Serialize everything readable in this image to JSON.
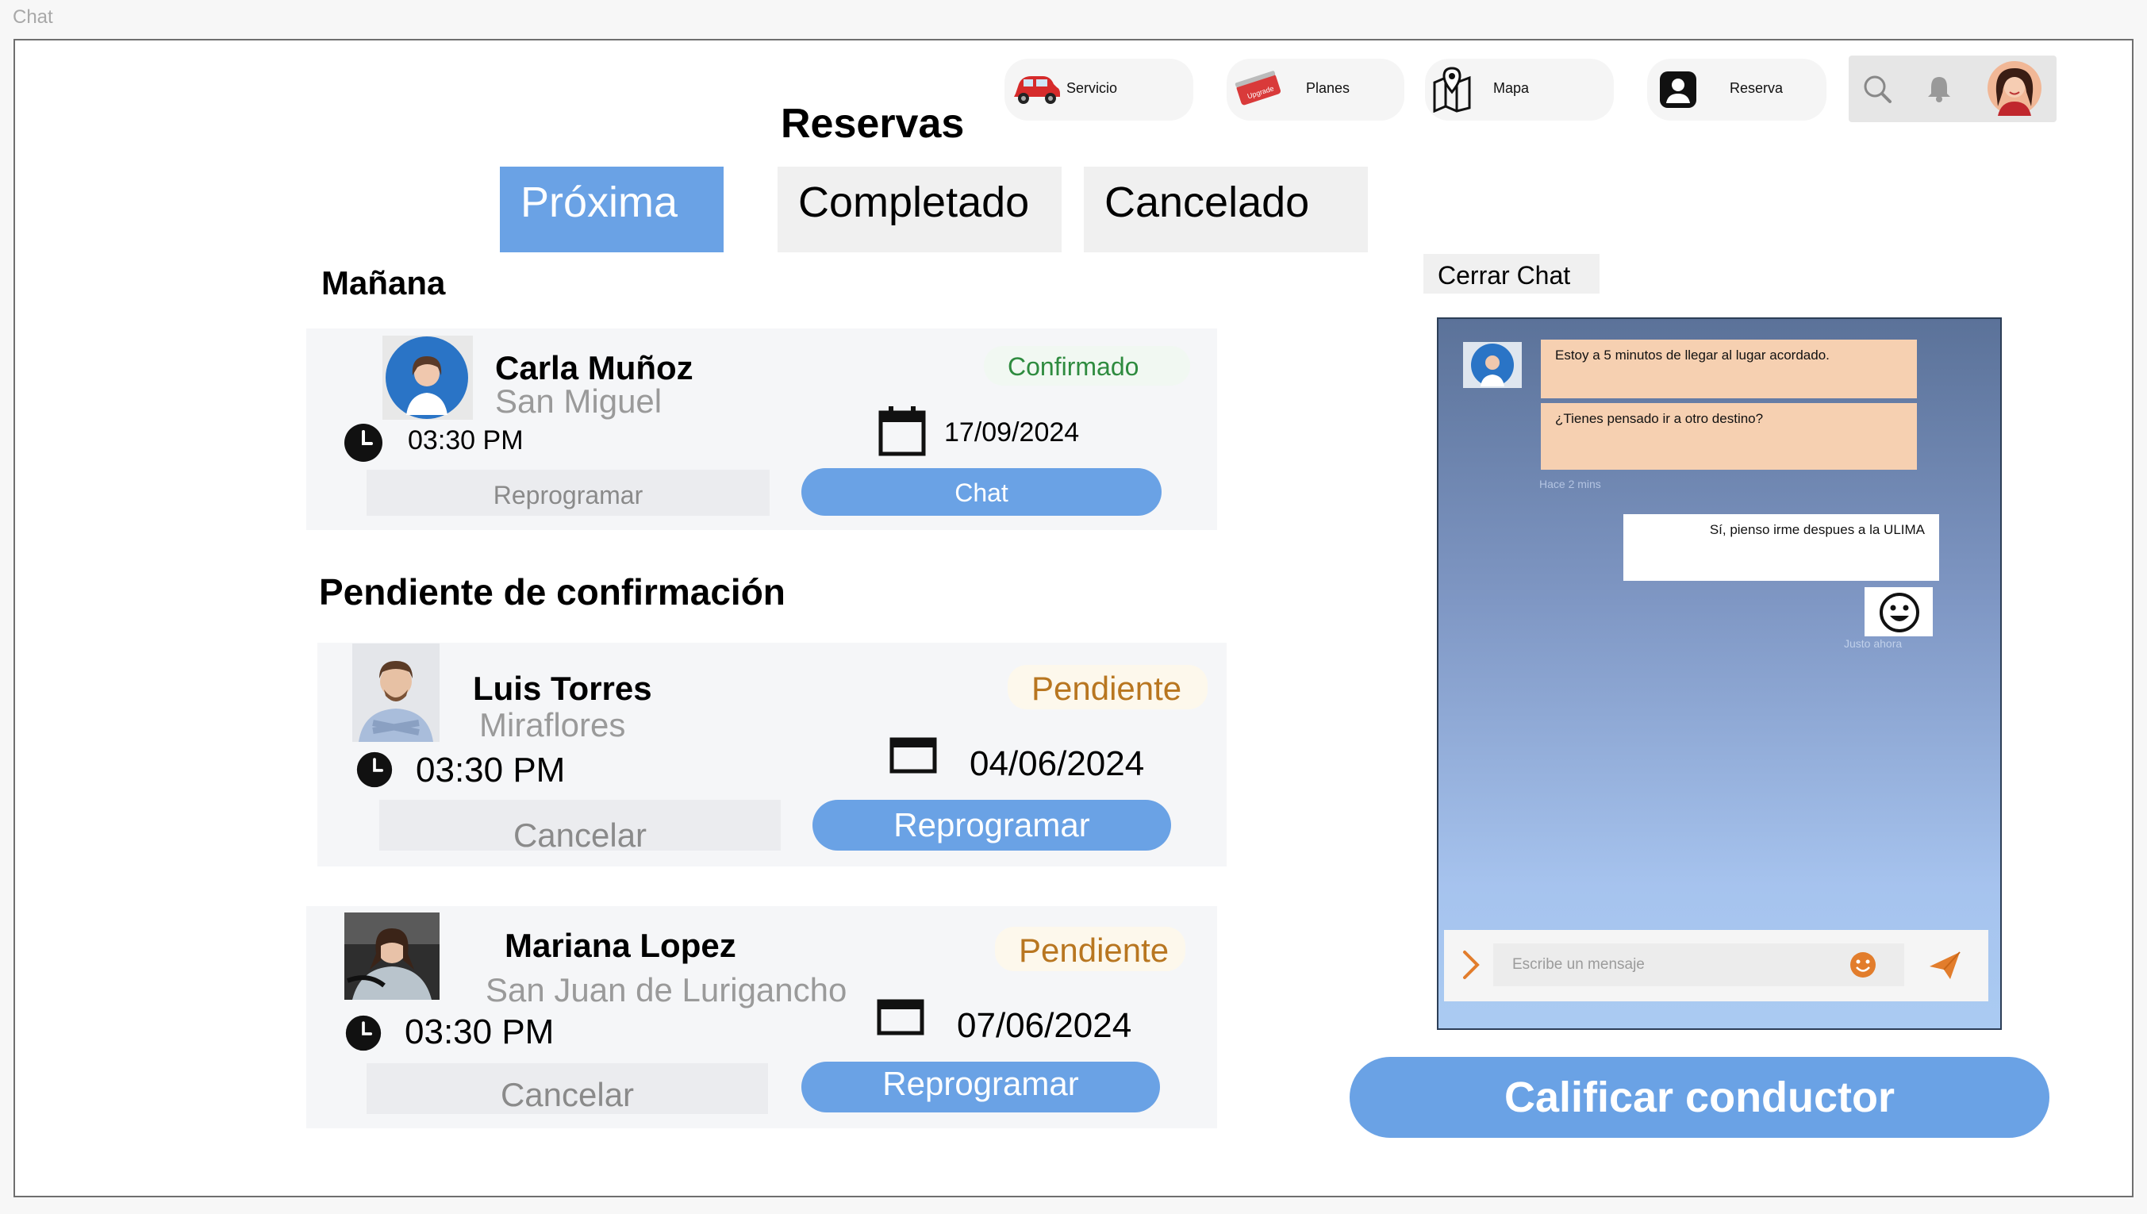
{
  "window": {
    "title": "Chat"
  },
  "nav": {
    "servicio": "Servicio",
    "planes": "Planes",
    "planes_badge": "Upgrade",
    "mapa": "Mapa",
    "reserva": "Reserva"
  },
  "page_title": "Reservas",
  "tabs": [
    {
      "label": "Próxima",
      "active": true
    },
    {
      "label": "Completado",
      "active": false
    },
    {
      "label": "Cancelado",
      "active": false
    }
  ],
  "sections": {
    "manana": "Mañana",
    "pendiente": "Pendiente de confirmación"
  },
  "bookings": [
    {
      "name": "Carla Muñoz",
      "place": "San Miguel",
      "time": "03:30 PM",
      "date": "17/09/2024",
      "status": "Confirmado",
      "secondary_button": "Reprogramar",
      "primary_button": "Chat"
    },
    {
      "name": "Luis Torres",
      "place": "Miraflores",
      "time": "03:30 PM",
      "date": "04/06/2024",
      "status": "Pendiente",
      "secondary_button": "Cancelar",
      "primary_button": "Reprogramar"
    },
    {
      "name": "Mariana Lopez",
      "place": "San Juan de Lurigancho",
      "time": "03:30 PM",
      "date": "07/06/2024",
      "status": "Pendiente",
      "secondary_button": "Cancelar",
      "primary_button": "Reprogramar"
    }
  ],
  "chat": {
    "close_label": "Cerrar Chat",
    "messages": [
      {
        "from": "driver",
        "text": "Estoy a 5 minutos de llegar al lugar acordado."
      },
      {
        "from": "driver",
        "text": "¿Tienes pensado ir a otro destino?"
      },
      {
        "from": "user",
        "text": "Sí, pienso irme despues a la ULIMA"
      }
    ],
    "meta_received": "Hace 2 mins",
    "meta_sent": "Justo ahora",
    "input_placeholder": "Escribe un mensaje"
  },
  "rate_button": "Calificar conductor",
  "colors": {
    "accent": "#6aa2e5",
    "confirmed": "#2e8b3f",
    "pending": "#b87620",
    "incoming_bubble": "#f6d0b1",
    "send_icon": "#e27d2c"
  }
}
